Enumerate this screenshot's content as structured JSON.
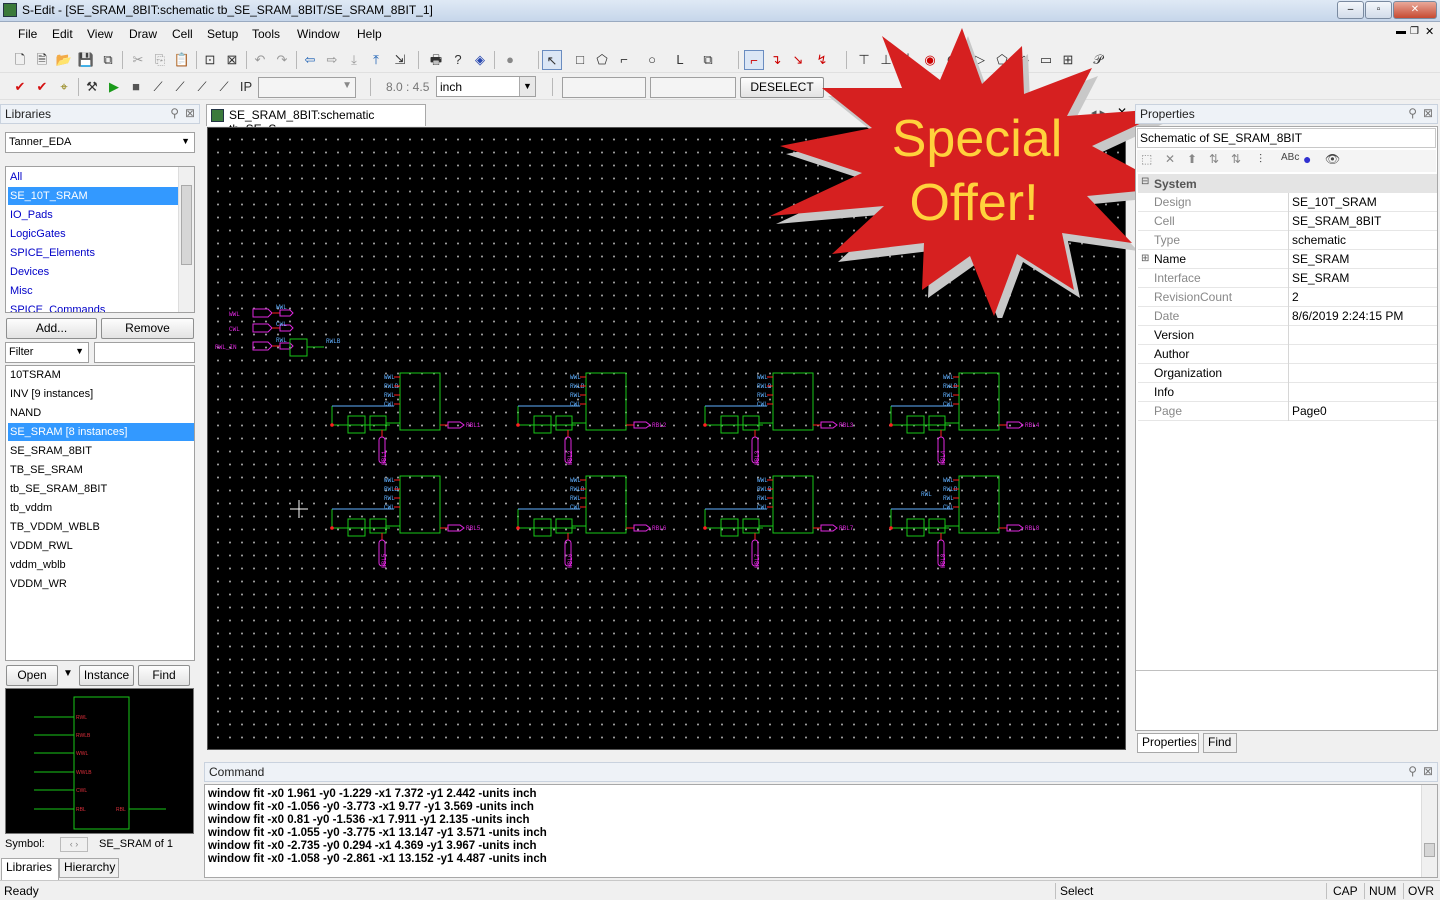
{
  "window": {
    "app_icon": "s-edit-icon",
    "title": "S-Edit - [SE_SRAM_8BIT:schematic tb_SE_SRAM_8BIT/SE_SRAM_8BIT_1]",
    "minimize": "‒",
    "maximize": "▫",
    "close": "✕"
  },
  "menu": [
    "File",
    "Edit",
    "View",
    "Draw",
    "Cell",
    "Setup",
    "Tools",
    "Window",
    "Help"
  ],
  "toolbar": {
    "coords": "8.0 : 4.5",
    "units": "inch",
    "deselect_label": "DESELECT"
  },
  "libraries": {
    "header": "Libraries",
    "selected_library": "Tanner_EDA",
    "items": [
      "All",
      "SE_10T_SRAM",
      "IO_Pads",
      "LogicGates",
      "SPICE_Elements",
      "Devices",
      "Misc",
      "SPICE_Commands"
    ],
    "selected_index": 1,
    "add_label": "Add...",
    "remove_label": "Remove",
    "filter_label": "Filter",
    "cells": [
      "10TSRAM",
      "INV [9 instances]",
      "NAND",
      "SE_SRAM [8 instances]",
      "SE_SRAM_8BIT",
      "TB_SE_SRAM",
      "tb_SE_SRAM_8BIT",
      "tb_vddm",
      "TB_VDDM_WBLB",
      "VDDM_RWL",
      "vddm_wblb",
      "VDDM_WR"
    ],
    "selected_cell_index": 3,
    "open_label": "Open",
    "instance_label": "Instance",
    "find_label": "Find",
    "symbol_label": "Symbol:",
    "symbol_value": "SE_SRAM of 1",
    "preview_pins": [
      "RWL",
      "RWLB",
      "WWL",
      "WWLB",
      "CWL",
      "RBL"
    ],
    "preview_out_pin": "RBL",
    "tabs": [
      "Libraries",
      "Hierarchy"
    ]
  },
  "document_tab": {
    "label": "SE_SRAM_8BIT:schematic tb_SE_S..."
  },
  "schematic": {
    "input_ports": [
      "WWL",
      "CWL",
      "RWL_IN"
    ],
    "driver_labels": [
      "WWL",
      "CWL",
      "RWL",
      "RWLB"
    ],
    "cell_pins": [
      "WWL",
      "RWLB",
      "RWL",
      "CWL"
    ],
    "rbl_labels": [
      "RBL1",
      "RBL2",
      "RBL3",
      "RBL4",
      "RBL5",
      "RBL6",
      "RBL7",
      "RBL8"
    ],
    "wbl_labels": [
      "WBL1",
      "WBL2",
      "WBL3",
      "WBL4",
      "WBL5",
      "WBL6",
      "WBL7",
      "WBL8"
    ],
    "extra_label": "RWL"
  },
  "banner": {
    "line1": "Special",
    "line2": "Offer!",
    "color": "#d62020",
    "text_color": "#ffd23c"
  },
  "properties": {
    "header": "Properties",
    "subject": "Schematic of SE_SRAM_8BIT",
    "section": "System",
    "rows": [
      {
        "key": "Design",
        "value": "SE_10T_SRAM",
        "readonly": true
      },
      {
        "key": "Cell",
        "value": "SE_SRAM_8BIT",
        "readonly": true
      },
      {
        "key": "Type",
        "value": "schematic",
        "readonly": true
      },
      {
        "key": "Name",
        "value": "SE_SRAM",
        "readonly": false,
        "expandable": true
      },
      {
        "key": "Interface",
        "value": "SE_SRAM",
        "readonly": true
      },
      {
        "key": "RevisionCount",
        "value": "2",
        "readonly": true
      },
      {
        "key": "Date",
        "value": "8/6/2019 2:24:15 PM",
        "readonly": true
      },
      {
        "key": "Version",
        "value": "",
        "readonly": false
      },
      {
        "key": "Author",
        "value": "",
        "readonly": false
      },
      {
        "key": "Organization",
        "value": "",
        "readonly": false
      },
      {
        "key": "Info",
        "value": "",
        "readonly": false
      },
      {
        "key": "Page",
        "value": "Page0",
        "readonly": true
      }
    ],
    "tabs": [
      "Properties",
      "Find"
    ]
  },
  "command": {
    "header": "Command",
    "lines": [
      "window fit -x0 1.961 -y0 -1.229 -x1 7.372 -y1 2.442 -units inch",
      "window fit -x0 -1.056 -y0 -3.773 -x1 9.77 -y1 3.569 -units inch",
      "window fit -x0 0.81 -y0 -1.536 -x1 7.911 -y1 2.135 -units inch",
      "window fit -x0 -1.055 -y0 -3.775 -x1 13.147 -y1 3.571 -units inch",
      "window fit -x0 -2.735 -y0 0.294 -x1 4.369 -y1 3.967 -units inch",
      "window fit -x0 -1.058 -y0 -2.861 -x1 13.152 -y1 4.487 -units inch"
    ]
  },
  "status": {
    "left": "Ready",
    "mode": "Select",
    "cap": "CAP",
    "num": "NUM",
    "ovr": "OVR"
  }
}
